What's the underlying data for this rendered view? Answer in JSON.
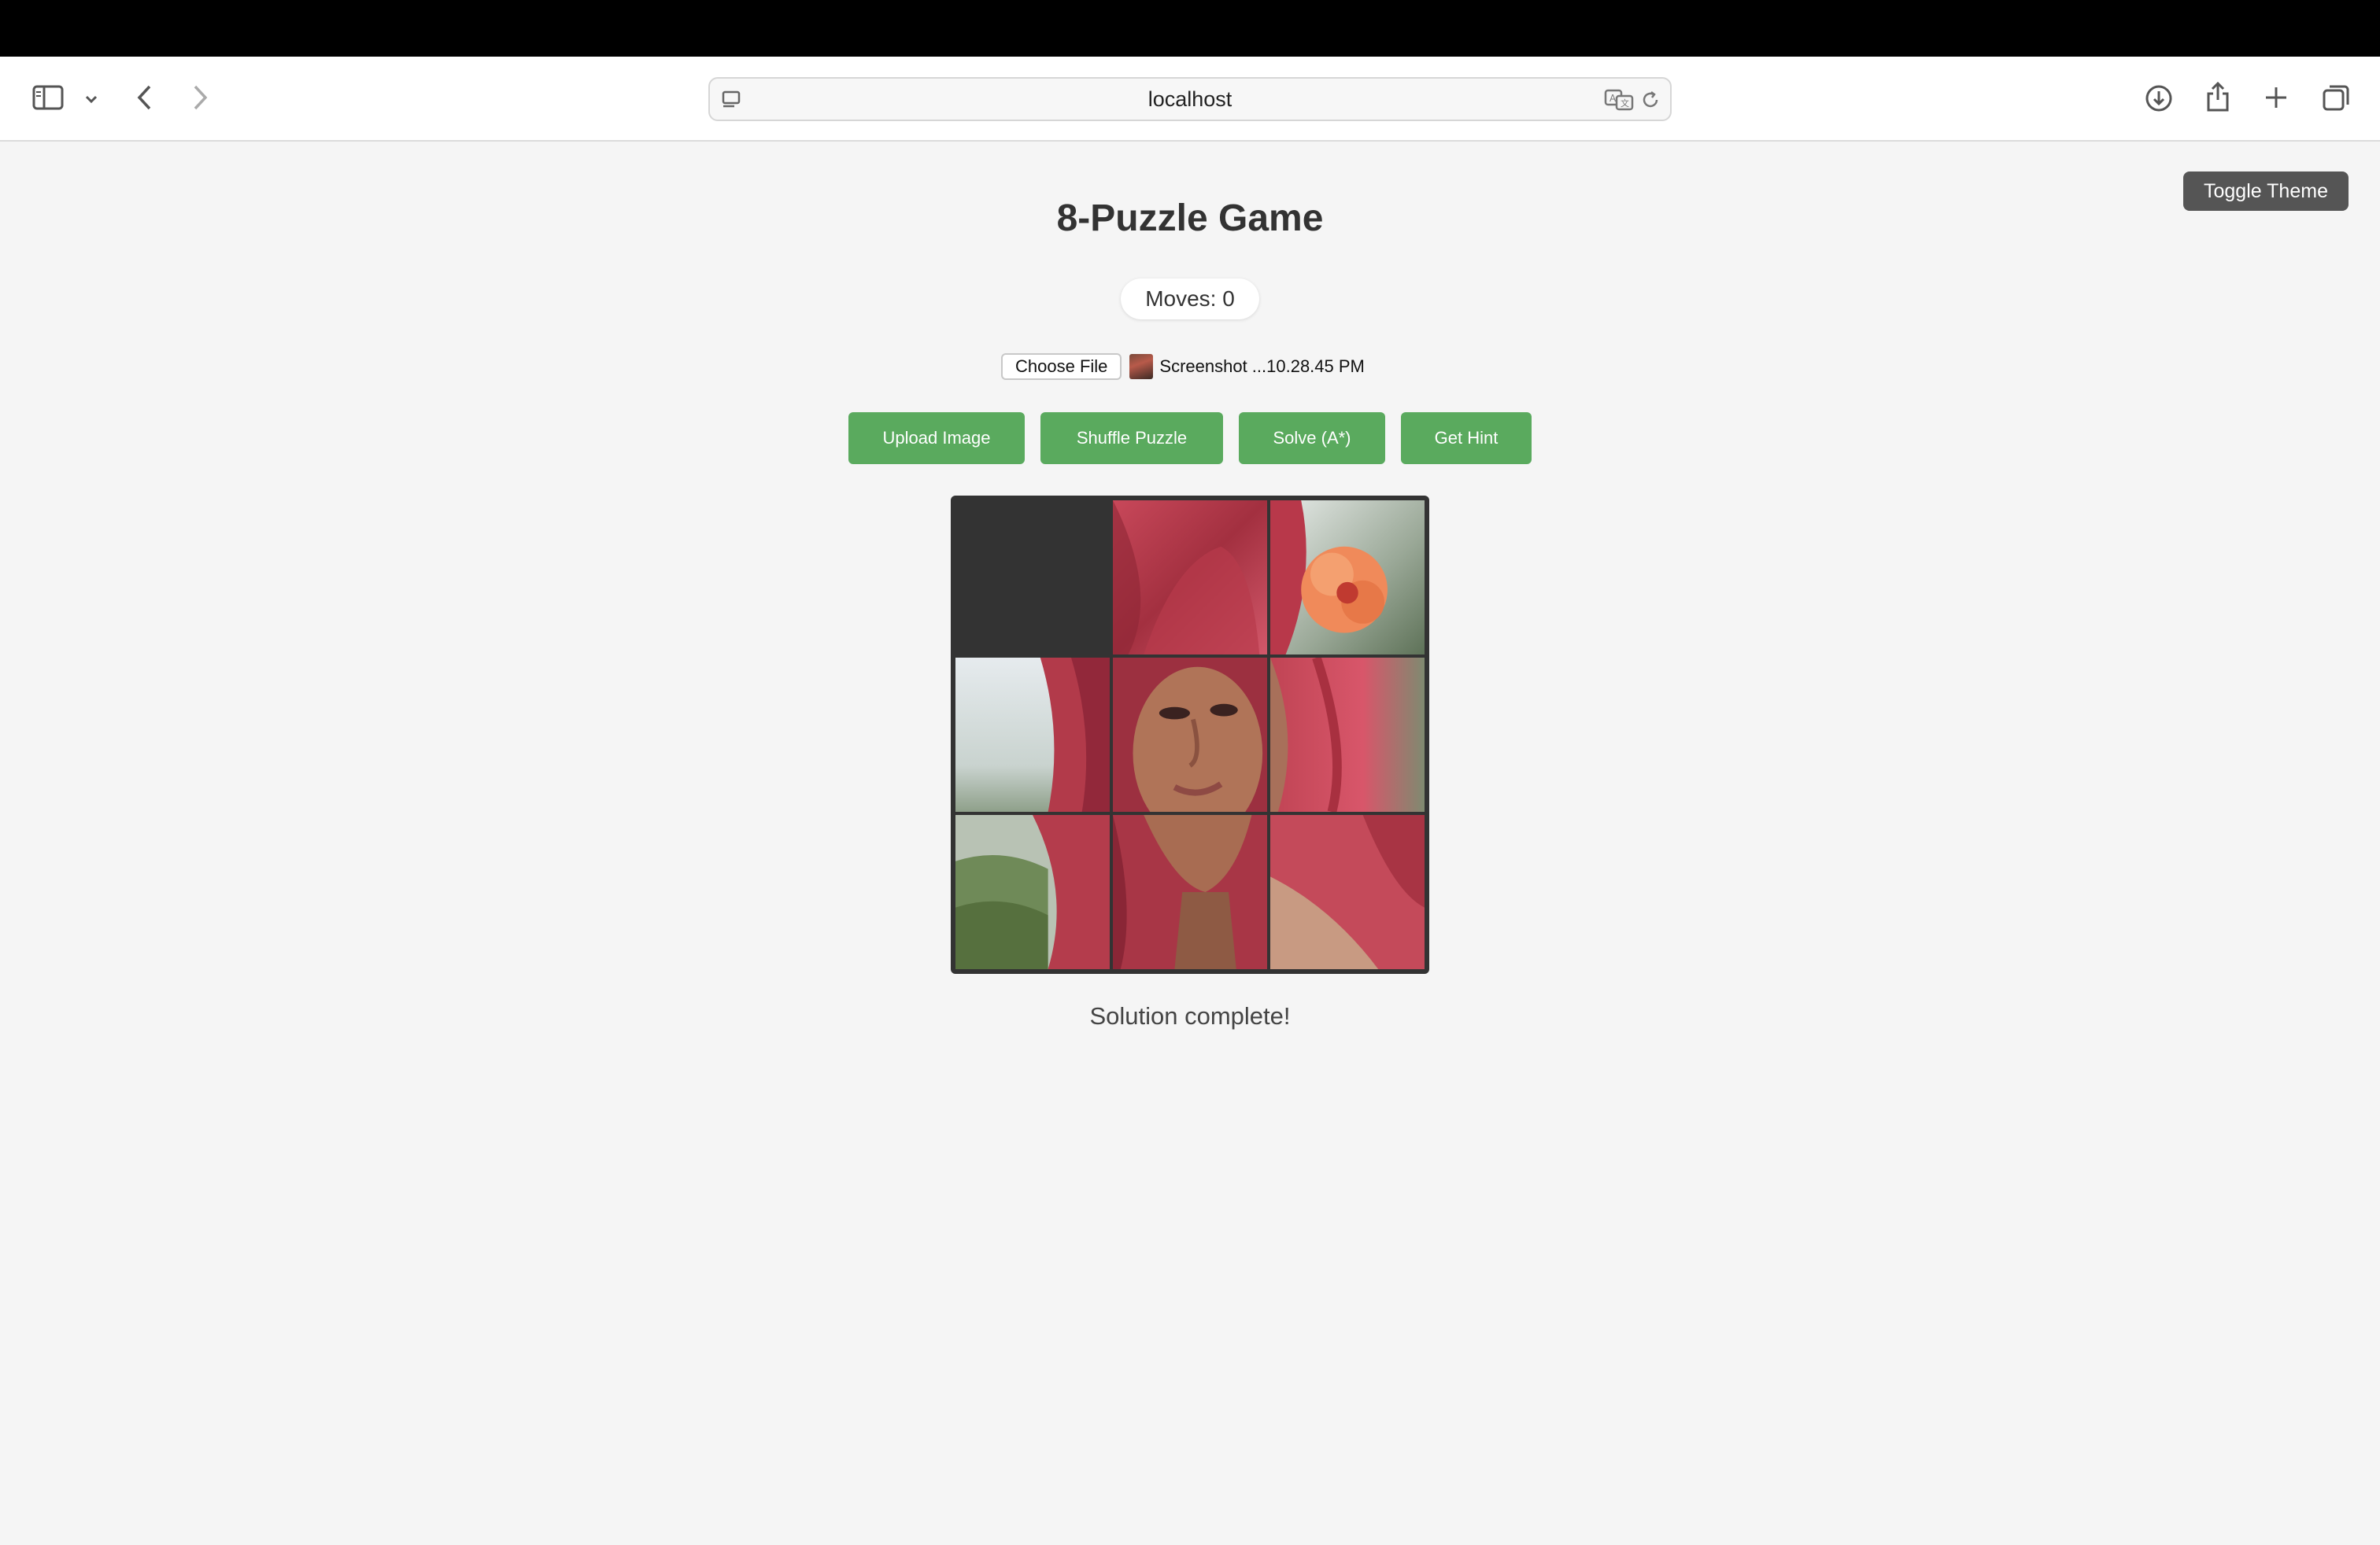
{
  "browser": {
    "url": "localhost"
  },
  "page": {
    "title": "8-Puzzle Game",
    "moves_label": "Moves: 0",
    "toggle_theme_label": "Toggle Theme",
    "file_input": {
      "button_label": "Choose File",
      "file_name": "Screenshot ...10.28.45 PM"
    },
    "buttons": {
      "upload": "Upload Image",
      "shuffle": "Shuffle Puzzle",
      "solve": "Solve (A*)",
      "hint": "Get Hint"
    },
    "status": "Solution complete!"
  },
  "puzzle": {
    "empty_tile_index": 0,
    "tiles": [
      "empty",
      "hair-top",
      "flower",
      "left-bg",
      "face",
      "hair-right",
      "hillside",
      "chin",
      "shoulder"
    ]
  },
  "colors": {
    "accent_green": "#5aaa5e",
    "board_dark": "#333333",
    "toggle_gray": "#555555"
  }
}
